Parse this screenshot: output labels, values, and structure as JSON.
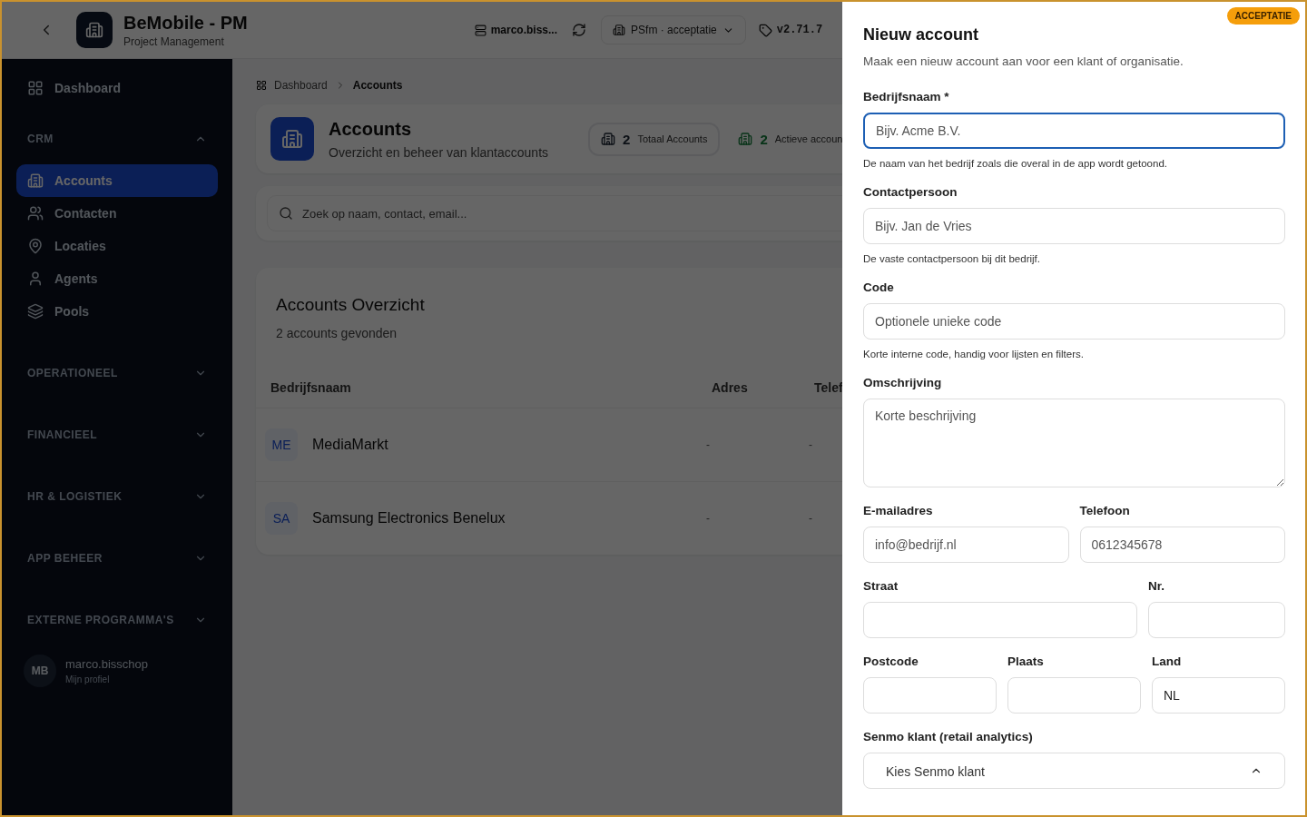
{
  "header": {
    "title": "BeMobile - PM",
    "subtitle": "Project Management",
    "user": "marco.biss...",
    "environment": "PSfm · acceptatie",
    "version": "v2.71.7"
  },
  "sidebar": {
    "top_item": {
      "label": "Dashboard",
      "selected": false
    },
    "sections": [
      {
        "title": "CRM",
        "expanded": true,
        "items": [
          {
            "label": "Accounts",
            "selected": true
          },
          {
            "label": "Contacten",
            "selected": false
          },
          {
            "label": "Locaties",
            "selected": false
          },
          {
            "label": "Agents",
            "selected": false
          },
          {
            "label": "Pools",
            "selected": false
          }
        ]
      },
      {
        "title": "OPERATIONEEL",
        "expanded": false
      },
      {
        "title": "FINANCIEEL",
        "expanded": false
      },
      {
        "title": "HR & LOGISTIEK",
        "expanded": false
      },
      {
        "title": "APP BEHEER",
        "expanded": false
      },
      {
        "title": "EXTERNE PROGRAMMA'S",
        "expanded": false
      }
    ],
    "profile": {
      "initials": "MB",
      "name": "marco.bisschop",
      "link": "Mijn profiel"
    }
  },
  "breadcrumb": [
    "Dashboard",
    "Accounts"
  ],
  "page": {
    "title": "Accounts",
    "subtitle": "Overzicht en beheer van klantaccounts",
    "stats": [
      {
        "value": "2",
        "label": "Totaal Accounts"
      },
      {
        "value": "2",
        "label": "Actieve accoun"
      }
    ]
  },
  "search": {
    "placeholder": "Zoek op naam, contact, email..."
  },
  "table": {
    "title": "Accounts Overzicht",
    "subtitle": "2 accounts gevonden",
    "columns": [
      "Bedrijfsnaam",
      "Adres",
      "Telef"
    ],
    "rows": [
      {
        "initials": "ME",
        "name": "MediaMarkt",
        "address": "-",
        "phone": "-"
      },
      {
        "initials": "SA",
        "name": "Samsung Electronics Benelux",
        "address": "-",
        "phone": "-"
      }
    ]
  },
  "drawer": {
    "badge": "ACCEPTATIE",
    "title": "Nieuw account",
    "description": "Maak een nieuw account aan voor een klant of organisatie.",
    "rows": [
      [
        {
          "label": "Bedrijfsnaam *",
          "kind": "input",
          "placeholder": "Bijv. Acme B.V.",
          "help": "De naam van het bedrijf zoals die overal in de app wordt getoond.",
          "focused": true
        }
      ],
      [
        {
          "label": "Contactpersoon",
          "kind": "input",
          "placeholder": "Bijv. Jan de Vries",
          "help": "De vaste contactpersoon bij dit bedrijf.",
          "focused": false
        }
      ],
      [
        {
          "label": "Code",
          "kind": "input",
          "placeholder": "Optionele unieke code",
          "help": "Korte interne code, handig voor lijsten en filters.",
          "focused": false
        }
      ],
      [
        {
          "label": "Omschrijving",
          "kind": "textarea",
          "placeholder": "Korte beschrijving",
          "focused": false
        }
      ],
      [
        {
          "label": "E-mailadres",
          "kind": "input",
          "placeholder": "info@bedrijf.nl",
          "focused": false
        },
        {
          "label": "Telefoon",
          "kind": "input",
          "placeholder": "0612345678",
          "focused": false
        }
      ],
      [
        {
          "label": "Straat",
          "kind": "input",
          "focused": false
        },
        {
          "label": "Nr.",
          "kind": "input",
          "focused": false
        }
      ],
      [
        {
          "label": "Postcode",
          "kind": "input",
          "focused": false
        },
        {
          "label": "Plaats",
          "kind": "input",
          "focused": false
        },
        {
          "label": "Land",
          "kind": "input",
          "value": "NL",
          "focused": false
        }
      ],
      [
        {
          "label": "Senmo klant (retail analytics)",
          "kind": "select",
          "placeholder": "Kies Senmo klant",
          "focused": false
        }
      ]
    ]
  }
}
